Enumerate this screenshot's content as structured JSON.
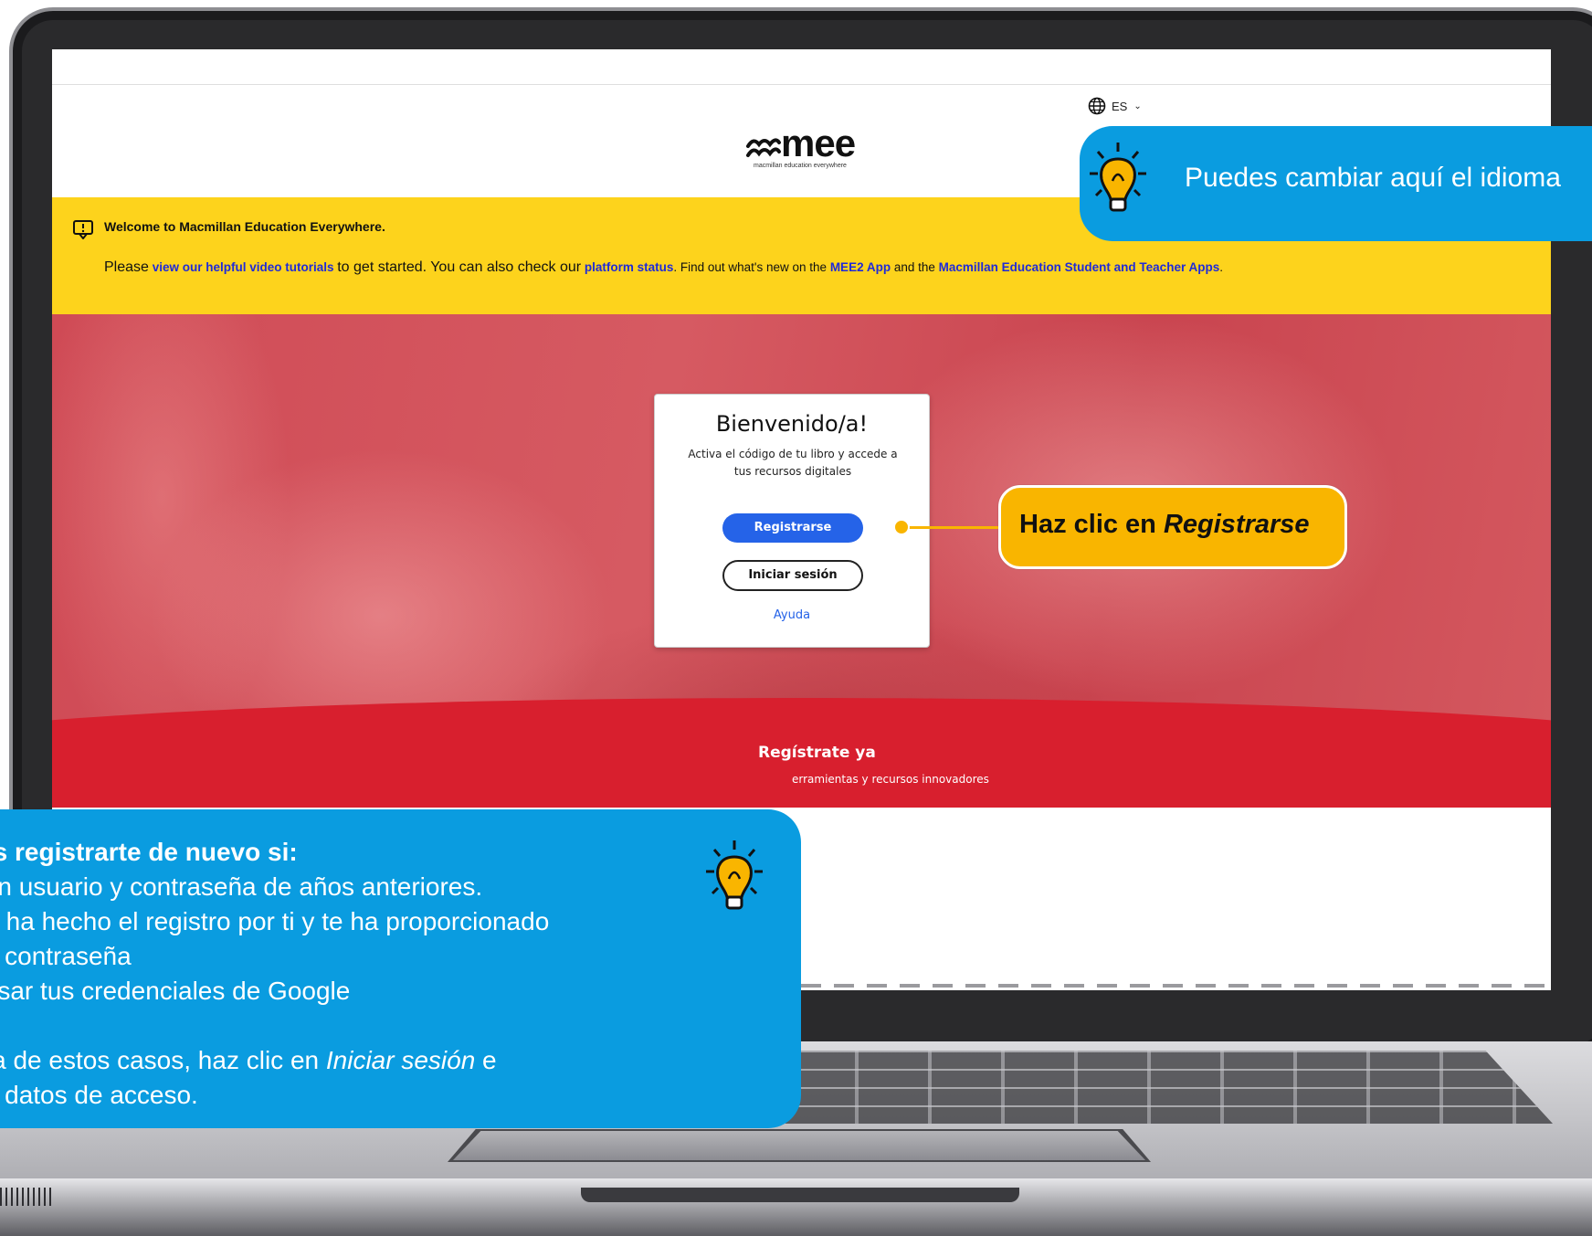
{
  "header": {
    "language_label": "ES",
    "logo_word": "mee",
    "logo_tagline": "macmillan education everywhere"
  },
  "notice": {
    "title": "Welcome to Macmillan Education Everywhere.",
    "text_please": "Please",
    "link_tutorials": "view our helpful video tutorials",
    "text_started": "to get started. You can also check our",
    "link_status": "platform status",
    "text_findout": ". Find out what's new on the",
    "link_mee2": "MEE2 App",
    "text_and": "and the",
    "link_apps": "Macmillan Education Student and Teacher Apps",
    "text_end": "."
  },
  "login_card": {
    "title": "Bienvenido/a!",
    "subtitle": "Activa el código de tu libro y accede a tus recursos digitales",
    "register_label": "Registrarse",
    "login_label": "Iniciar sesión",
    "help_label": "Ayuda"
  },
  "promo": {
    "title": "Regístrate ya",
    "subtitle": "erramientas y recursos innovadores"
  },
  "callouts": {
    "language_tip": "Puedes cambiar aquí el idioma",
    "register_tip_prefix": "Haz clic en ",
    "register_tip_emphasis": "Registrarse",
    "info_line1": "itas registrarte de nuevo si:",
    "info_line2": "s un usuario y contraseña de años anteriores.",
    "info_line3": "sor ha hecho el registro por ti y te ha proporcionado",
    "info_line4": "o y contraseña",
    "info_line5": "s usar tus credenciales de Google",
    "info_line6_prefix": "iera de estos casos, haz clic en ",
    "info_line6_emphasis": "Iniciar sesión",
    "info_line6_suffix": " e",
    "info_line7": "tus datos de acceso."
  },
  "colors": {
    "callout_blue": "#0a9ce0",
    "callout_yellow": "#f9b500",
    "notice_yellow": "#fdd31c",
    "brand_red": "#d81f2e",
    "button_blue": "#2563e8"
  },
  "icons": [
    "globe-icon",
    "chevron-down-icon",
    "notice-icon",
    "mee-logo-mark",
    "lightbulb-icon"
  ]
}
